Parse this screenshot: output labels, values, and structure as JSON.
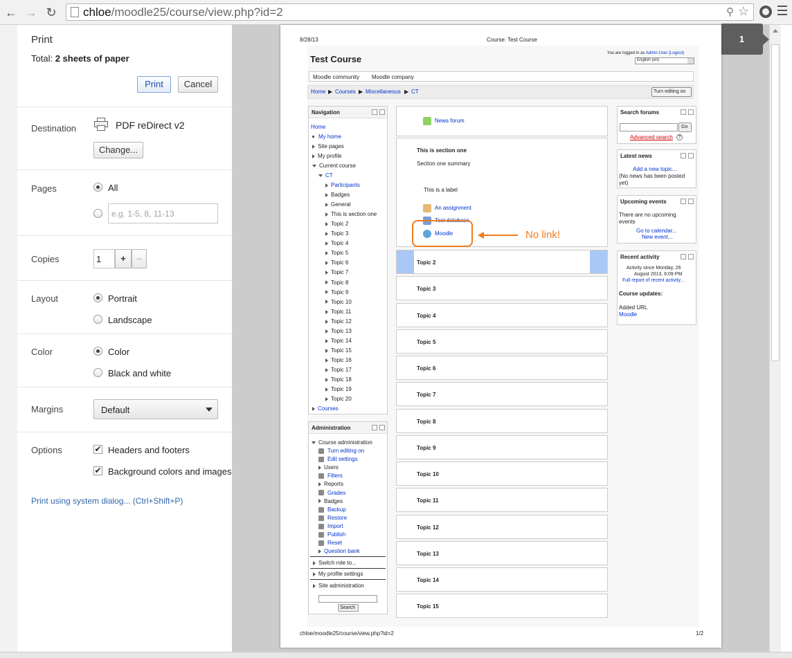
{
  "browser": {
    "url_host": "chloe",
    "url_path": "/moodle25/course/view.php?id=2"
  },
  "print_panel": {
    "title": "Print",
    "total_label": "Total:",
    "total_value": "2 sheets of paper",
    "print_button": "Print",
    "cancel_button": "Cancel",
    "destination_label": "Destination",
    "destination_value": "PDF reDirect v2",
    "change_button": "Change...",
    "pages_label": "Pages",
    "pages_all": "All",
    "pages_placeholder": "e.g. 1-5, 8, 11-13",
    "copies_label": "Copies",
    "copies_value": "1",
    "copies_plus": "+",
    "copies_minus": "–",
    "layout_label": "Layout",
    "layout_portrait": "Portrait",
    "layout_landscape": "Landscape",
    "color_label": "Color",
    "color_color": "Color",
    "color_bw": "Black and white",
    "margins_label": "Margins",
    "margins_value": "Default",
    "options_label": "Options",
    "option_headers": "Headers and footers",
    "option_background": "Background colors and images",
    "system_dialog_link": "Print using system dialog... (Ctrl+Shift+P)"
  },
  "preview": {
    "page_badge": "1",
    "header_date": "8/28/13",
    "header_title": "Course: Test Course",
    "footer_url": "chloe/moodle25/course/view.php?id=2",
    "footer_page": "1/2",
    "course_title": "Test Course",
    "logged_in_text": "You are logged in as",
    "user_link": "Admin User",
    "logout_link": "(Logout)",
    "language": "English (en)",
    "custom_menu": [
      "Moodle community",
      "Moodle company"
    ],
    "breadcrumb": [
      "Home",
      "Courses",
      "Miscellaneous",
      "CT"
    ],
    "turn_editing_button": "Turn editing on",
    "navigation": {
      "title": "Navigation",
      "home": "Home",
      "items": [
        "My home",
        "Site pages",
        "My profile",
        "Current course"
      ],
      "course": "CT",
      "course_items": [
        "Participants",
        "Badges",
        "General",
        "This is section one",
        "Topic 2",
        "Topic 3",
        "Topic 4",
        "Topic 5",
        "Topic 6",
        "Topic 7",
        "Topic 8",
        "Topic 9",
        "Topic 10",
        "Topic 11",
        "Topic 12",
        "Topic 13",
        "Topic 14",
        "Topic 15",
        "Topic 16",
        "Topic 17",
        "Topic 18",
        "Topic 19",
        "Topic 20"
      ],
      "courses": "Courses"
    },
    "administration": {
      "title": "Administration",
      "course_admin": "Course administration",
      "items": [
        "Turn editing on",
        "Edit settings",
        "Users",
        "Filters",
        "Reports",
        "Grades",
        "Badges",
        "Backup",
        "Restore",
        "Import",
        "Publish",
        "Reset",
        "Question bank"
      ],
      "switch_role": "Switch role to...",
      "my_profile_settings": "My profile settings",
      "site_admin": "Site administration",
      "search_button": "Search"
    },
    "sections": {
      "news_forum": "News forum",
      "section_one_title": "This is section one",
      "section_one_summary": "Section one summary",
      "label_text": "This is a label",
      "assignment": "An assignment",
      "database": "Test database",
      "url_resource": "Moodle",
      "annotation": "No link!",
      "topics": [
        "Topic 2",
        "Topic 3",
        "Topic 4",
        "Topic 5",
        "Topic 6",
        "Topic 7",
        "Topic 8",
        "Topic 9",
        "Topic 10",
        "Topic 11",
        "Topic 12",
        "Topic 13",
        "Topic 14",
        "Topic 15"
      ]
    },
    "search_forums": {
      "title": "Search forums",
      "go_button": "Go",
      "advanced": "Advanced search"
    },
    "latest_news": {
      "title": "Latest news",
      "add_topic": "Add a new topic...",
      "empty_text_1": "(No news has been posted",
      "empty_text_2": "yet)"
    },
    "upcoming_events": {
      "title": "Upcoming events",
      "text_1": "There are no upcoming",
      "text_2": "events",
      "calendar_link": "Go to calendar...",
      "new_event_link": "New event..."
    },
    "recent_activity": {
      "title": "Recent activity",
      "since_1": "Activity since Monday, 26",
      "since_2": "August 2013, 6:09 PM",
      "full_report": "Full report of recent activity...",
      "updates_heading": "Course updates:",
      "added_url": "Added URL",
      "url_link": "Moodle"
    }
  },
  "colors": {
    "link": "#0033cc",
    "annotation": "#f07c1a",
    "highlight": "#a9c8f5"
  }
}
